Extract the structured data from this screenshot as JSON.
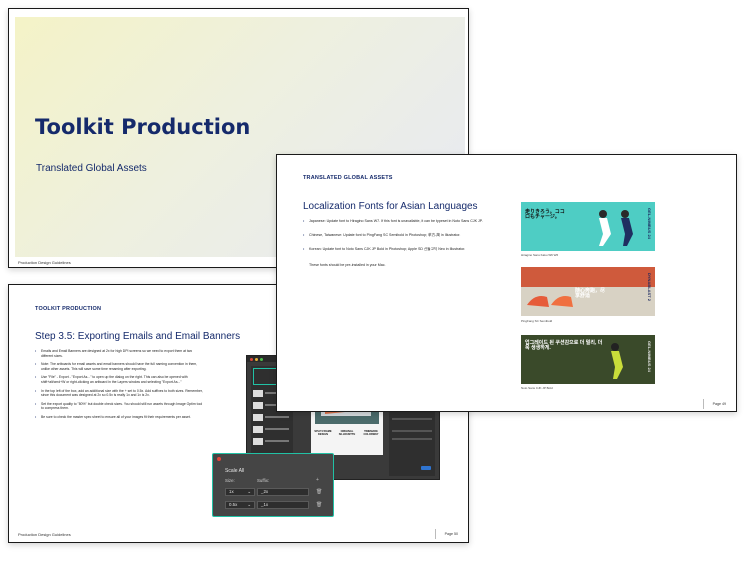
{
  "slide1": {
    "title": "Toolkit Production",
    "subtitle": "Translated Global Assets",
    "footer": "Production Design Guidelines"
  },
  "slide2": {
    "header": "TRANSLATED GLOBAL ASSETS",
    "title": "Localization Fonts for Asian Languages",
    "bullets": [
      "Japanese: Update font to Hiragino Sans W7. If this font is unavailable, it can be typeset in Noto Sans CJK JP.",
      "Chinese, Taiwanese: Update font to PingFang SC Semibold in Photoshop; 苹方-简 in Illustrator.",
      "Korean: Update font to Noto Sans CJK JP Bold in Photoshop; Apple SD 산돌고딕 Neo in Illustrator."
    ],
    "note": "These fonts should be pre-installed in your Mac.",
    "banners": [
      {
        "text": "走りきろう。ココロもチャージ。",
        "side": "GEL-NIMBUS 24",
        "caption": "Hiragino Sans Kaku W6 W6",
        "bg": "#4ecdc4"
      },
      {
        "text": "随心奔跑，尽享舒适",
        "side": "DYNABLAST 2",
        "caption": "PingFang SC Semibold",
        "bg": "#d8d2c4"
      },
      {
        "text": "업그레이드 된 쿠션감으로 더 멀리, 더욱 생생하게.",
        "side": "GEL-NIMBUS 24",
        "caption": "Noto Sans CJK JP Bold",
        "bg": "#3a4a2a"
      }
    ],
    "page": "Page 49"
  },
  "slide3": {
    "header": "TOOLKIT PRODUCTION",
    "title": "Step 3.5: Exporting Emails and Email Banners",
    "bullets": [
      "Emails and Email Banners are designed at 2x for high DPI screens so we need to export them at two different sizes.",
      "Note: The artboards for email assets and email banners should have the full naming convention in them, unlike other assets. This will save some time renaming after exporting.",
      "Use \"File\" - Export - \"Export As...\" to open up the dialog on the right. This can also be opened with shift+alt/cmd+W or right-clicking an artboard in the Layers window and selecting \"Export As...\"",
      "In the top left of the box, add an additional size with the + set to 0.5x. Add suffixes to both sizes. Remember, since this document was designed at 2x so 0.5x is really 1x and 1x is 2x.",
      "Set the export quality to \"80%\" but double check sizes. You should still run assets through Image Optim tool to compress them.",
      "Be sure to check the master spec sheet to ensure all of your images fit their requirements per asset."
    ],
    "footer": "Production Design Guidelines",
    "page": "Page 50",
    "dialog": {
      "title": "Scale All",
      "size_label": "Size:",
      "suffix_label": "Suffix:",
      "rows": [
        {
          "size": "1x",
          "suffix": "_2x"
        },
        {
          "size": "0.5x",
          "suffix": "_1x"
        }
      ]
    },
    "canvas_labels": [
      "SPLIT-FRAME DESIGN",
      "ORIGINAL SILHOUETTE",
      "TIMEMADE COLORWAY"
    ]
  },
  "colors": {
    "navy": "#152a6b",
    "teal_highlight": "#21c1a5"
  }
}
